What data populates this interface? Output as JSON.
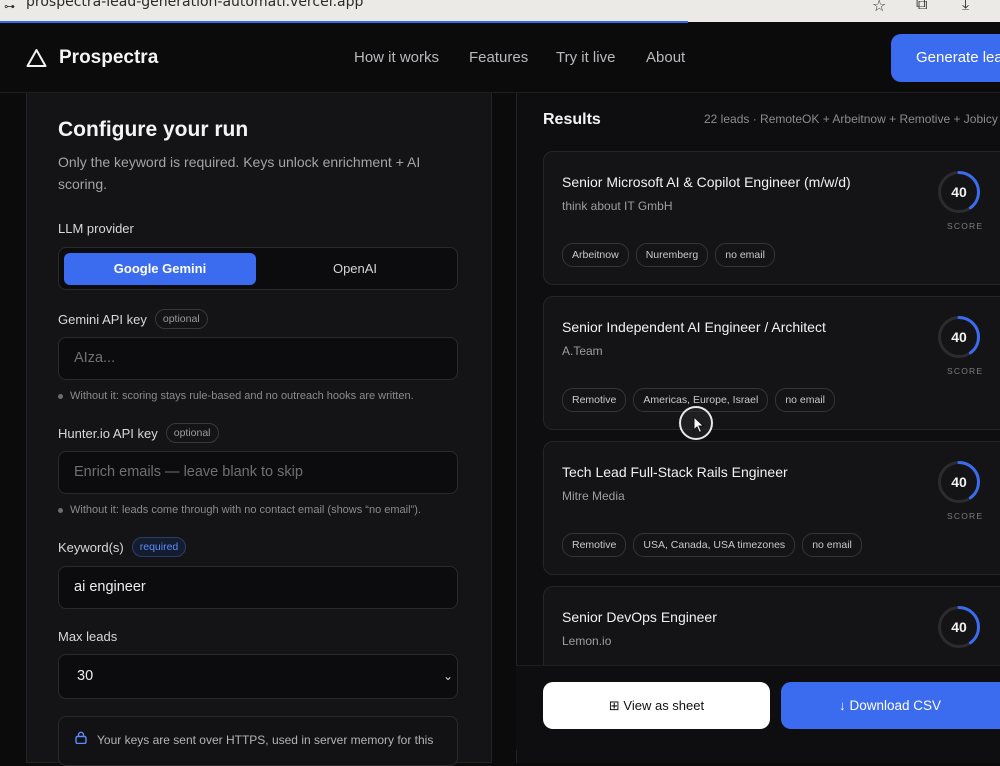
{
  "browser": {
    "url": "prospectra-lead-generation-automati.vercel.app"
  },
  "header": {
    "brand": "Prospectra",
    "nav": [
      "How it works",
      "Features",
      "Try it live",
      "About"
    ],
    "cta": "Generate leads"
  },
  "form": {
    "title": "Configure your run",
    "subtitle": "Only the keyword is required. Keys unlock enrichment + AI scoring.",
    "llm_label": "LLM provider",
    "providers": [
      "Google Gemini",
      "OpenAI"
    ],
    "selected_provider": "Google Gemini",
    "gemini": {
      "label": "Gemini API key",
      "badge": "optional",
      "placeholder": "AIza...",
      "hint": "Without it: scoring stays rule-based and no outreach hooks are written."
    },
    "hunter": {
      "label": "Hunter.io API key",
      "badge": "optional",
      "placeholder": "Enrich emails — leave blank to skip",
      "hint": "Without it: leads come through with no contact email (shows “no email”)."
    },
    "keyword": {
      "label": "Keyword(s)",
      "badge": "required",
      "value": "ai engineer"
    },
    "max_leads": {
      "label": "Max leads",
      "value": "30"
    },
    "notice": "Your keys are sent over HTTPS, used in server memory for this"
  },
  "results": {
    "title": "Results",
    "meta": "22 leads · RemoteOK + Arbeitnow + Remotive + Jobicy",
    "score_label": "SCORE",
    "leads": [
      {
        "title": "Senior Microsoft AI & Copilot Engineer (m/w/d)",
        "company": "think about IT GmbH",
        "score": 40,
        "tags": [
          "Arbeitnow",
          "Nuremberg",
          "no email"
        ]
      },
      {
        "title": "Senior Independent AI Engineer / Architect",
        "company": "A.Team",
        "score": 40,
        "tags": [
          "Remotive",
          "Americas, Europe, Israel",
          "no email"
        ]
      },
      {
        "title": "Tech Lead Full-Stack Rails Engineer",
        "company": "Mitre Media",
        "score": 40,
        "tags": [
          "Remotive",
          "USA, Canada, USA timezones",
          "no email"
        ]
      },
      {
        "title": "Senior DevOps Engineer",
        "company": "Lemon.io",
        "score": 40,
        "tags": []
      }
    ],
    "view_sheet": "View as sheet",
    "download_csv": "Download CSV"
  },
  "colors": {
    "accent": "#3b6cf0",
    "background": "#0b0b0c",
    "panel": "#141416"
  }
}
